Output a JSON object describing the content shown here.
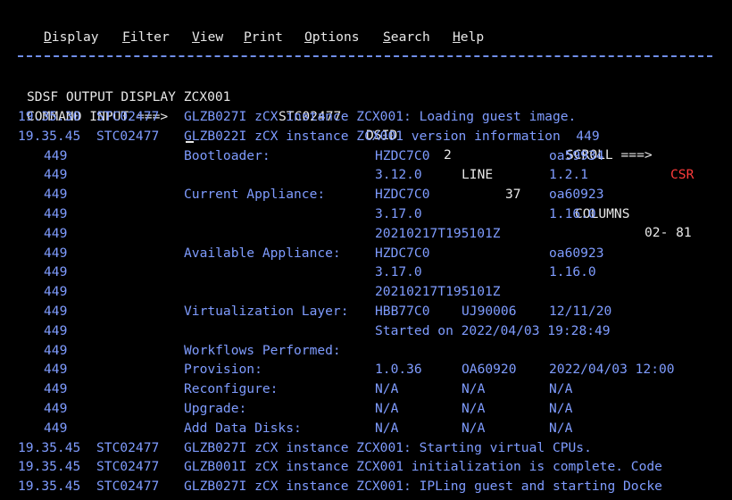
{
  "menu": {
    "items": [
      {
        "hot": "D",
        "rest": "isplay"
      },
      {
        "hot": "F",
        "rest": "ilter"
      },
      {
        "hot": "V",
        "rest": "iew"
      },
      {
        "hot": "P",
        "rest": "rint"
      },
      {
        "hot": "O",
        "rest": "ptions"
      },
      {
        "hot": "S",
        "rest": "earch"
      },
      {
        "hot": "H",
        "rest": "elp"
      }
    ]
  },
  "header": {
    "title": "SDSF OUTPUT DISPLAY ZCX001",
    "jobid": "STC02477",
    "dsid_label": "DSID",
    "dsid_value": "2",
    "line_label": "LINE",
    "line_value": "37",
    "columns_label": "COLUMNS",
    "columns_value": "02- 81",
    "command_label": "COMMAND INPUT ===>",
    "command_value": "",
    "scroll_label": "SCROLL ===>",
    "scroll_value": "CSR"
  },
  "log": {
    "top_lines": [
      {
        "time": "19.35.30",
        "job": "STC02477",
        "text": "GLZB027I zCX instance ZCX001: Loading guest image."
      },
      {
        "time": "19.35.45",
        "job": "STC02477",
        "text": "GLZB022I zCX instance ZCX001 version information  449"
      }
    ],
    "detail_rows": [
      {
        "num": "449",
        "label": "Bootloader:",
        "c1": "HZDC7C0",
        "c2": "",
        "c3": "oa59934"
      },
      {
        "num": "449",
        "label": "",
        "c1": "3.12.0",
        "c2": "",
        "c3": "1.2.1"
      },
      {
        "num": "449",
        "label": "Current Appliance:",
        "c1": "HZDC7C0",
        "c2": "",
        "c3": "oa60923"
      },
      {
        "num": "449",
        "label": "",
        "c1": "3.17.0",
        "c2": "",
        "c3": "1.16.0"
      },
      {
        "num": "449",
        "label": "",
        "c1": "20210217T195101Z",
        "c2": "",
        "c3": ""
      },
      {
        "num": "449",
        "label": "Available Appliance:",
        "c1": "HZDC7C0",
        "c2": "",
        "c3": "oa60923"
      },
      {
        "num": "449",
        "label": "",
        "c1": "3.17.0",
        "c2": "",
        "c3": "1.16.0"
      },
      {
        "num": "449",
        "label": "",
        "c1": "20210217T195101Z",
        "c2": "",
        "c3": ""
      },
      {
        "num": "449",
        "label": "Virtualization Layer:",
        "c1": "HBB77C0",
        "c2": "UJ90006",
        "c3": "12/11/20"
      },
      {
        "num": "449",
        "label": "",
        "c1": "Started on 2022/04/03 19:28:49",
        "c2": "",
        "c3": ""
      },
      {
        "num": "449",
        "label": "Workflows Performed:",
        "c1": "",
        "c2": "",
        "c3": ""
      },
      {
        "num": "449",
        "label": "Provision:",
        "c1": "1.0.36",
        "c2": "OA60920",
        "c3": "2022/04/03 12:00"
      },
      {
        "num": "449",
        "label": "Reconfigure:",
        "c1": "N/A",
        "c2": "N/A",
        "c3": "N/A"
      },
      {
        "num": "449",
        "label": "Upgrade:",
        "c1": "N/A",
        "c2": "N/A",
        "c3": "N/A"
      },
      {
        "num": "449",
        "label": "Add Data Disks:",
        "c1": "N/A",
        "c2": "N/A",
        "c3": "N/A"
      }
    ],
    "bottom_lines": [
      {
        "time": "19.35.45",
        "job": "STC02477",
        "text": "GLZB027I zCX instance ZCX001: Starting virtual CPUs."
      },
      {
        "time": "19.35.45",
        "job": "STC02477",
        "text": "GLZB001I zCX instance ZCX001 initialization is complete. Code"
      },
      {
        "time": "19.35.45",
        "job": "STC02477",
        "text": "GLZB027I zCX instance ZCX001: IPLing guest and starting Docke"
      }
    ]
  }
}
